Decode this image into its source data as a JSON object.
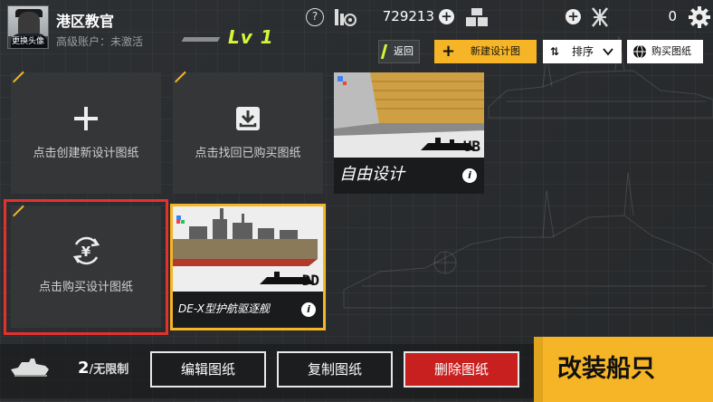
{
  "header": {
    "avatar_label": "更换头像",
    "player_name": "港区教官",
    "account_status": "高级账户：未激活",
    "level": "Lv 1",
    "help": "?",
    "resources": [
      {
        "icon": "coin-stack-icon",
        "value": "729213"
      },
      {
        "icon": "supply-crates-icon",
        "value": "0"
      },
      {
        "icon": "medal-emblem-icon",
        "value": "0"
      }
    ]
  },
  "toolbar": {
    "back_label": "返回",
    "new_design_label": "新建设计图",
    "sort_label": "排序",
    "buy_label": "购买图纸"
  },
  "cards": {
    "create_label": "点击创建新设计图纸",
    "recover_label": "点击找回已购买图纸",
    "buy_label": "点击购买设计图纸"
  },
  "designs": [
    {
      "name": "自由设计",
      "tag": "UB",
      "info": "i"
    },
    {
      "name": "DE-X型护航驱逐舰",
      "tag": "DD",
      "info": "i"
    }
  ],
  "bottom": {
    "ship_count": "2",
    "ship_limit": "/无限制",
    "edit_label": "编辑图纸",
    "copy_label": "复制图纸",
    "delete_label": "删除图纸",
    "refit_label": "改装船只"
  },
  "colors": {
    "accent_yellow": "#f5b526",
    "level_green": "#d6f53a",
    "delete_red": "#c81f1f",
    "highlight_red": "#e1322e"
  }
}
